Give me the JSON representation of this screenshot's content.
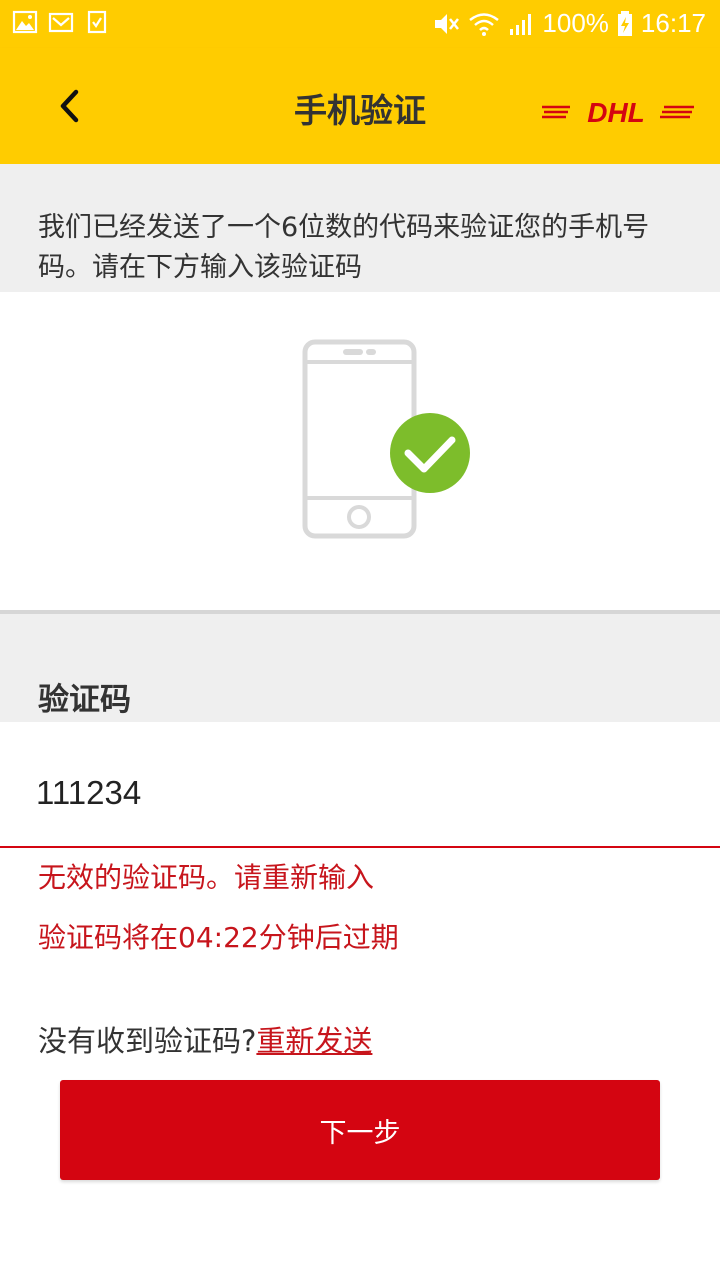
{
  "status_bar": {
    "battery": "100%",
    "time": "16:17",
    "left_icons": [
      "image-icon",
      "mail-icon",
      "clipboard-check-icon"
    ],
    "right_icons": [
      "mute-icon",
      "wifi-icon",
      "signal-icon",
      "battery-charging-icon"
    ]
  },
  "app_bar": {
    "title": "手机验证",
    "logo_text": "DHL",
    "back_icon": "chevron-left-icon"
  },
  "info": {
    "message": "我们已经发送了一个6位数的代码来验证您的手机号码。请在下方输入该验证码"
  },
  "illustration": {
    "icons": [
      "phone-icon",
      "checkmark-circle-icon"
    ],
    "check_color": "#7dbd2b"
  },
  "code_section": {
    "label": "验证码",
    "value": "111234"
  },
  "errors": {
    "invalid": "无效的验证码。请重新输入",
    "expiry": "验证码将在04:22分钟后过期"
  },
  "resend": {
    "prompt": "没有收到验证码?",
    "link": "重新发送"
  },
  "next_button": {
    "label": "下一步"
  },
  "colors": {
    "brand_yellow": "#ffcc00",
    "brand_red": "#d40511",
    "error_red": "#c7151c",
    "background_gray": "#efefef"
  }
}
